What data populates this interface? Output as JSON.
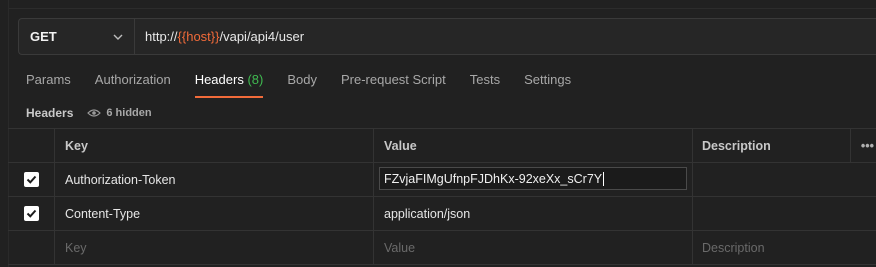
{
  "request": {
    "method": "GET",
    "url_prefix": "http://",
    "url_variable": "{{host}}",
    "url_suffix": "/vapi/api4/user"
  },
  "tabs": [
    {
      "label": "Params"
    },
    {
      "label": "Authorization"
    },
    {
      "label": "Headers",
      "count": "(8)",
      "active": true
    },
    {
      "label": "Body"
    },
    {
      "label": "Pre-request Script"
    },
    {
      "label": "Tests"
    },
    {
      "label": "Settings"
    }
  ],
  "headers_section": {
    "label": "Headers",
    "hidden_text": "6 hidden"
  },
  "table": {
    "columns": {
      "key": "Key",
      "value": "Value",
      "description": "Description",
      "more": "•••"
    },
    "rows": [
      {
        "key": "Authorization-Token",
        "value": "FZvjaFIMgUfnpFJDhKx-92xeXx_sCr7Y",
        "checked": true
      },
      {
        "key": "Content-Type",
        "value": "application/json",
        "checked": true
      }
    ],
    "placeholder": {
      "key": "Key",
      "value": "Value",
      "description": "Description"
    }
  },
  "colors": {
    "accent": "#f26b3a",
    "count": "#3fb950"
  },
  "icons": [
    "chevron-down-icon",
    "eye-icon",
    "checkmark-icon",
    "more-options-icon"
  ]
}
